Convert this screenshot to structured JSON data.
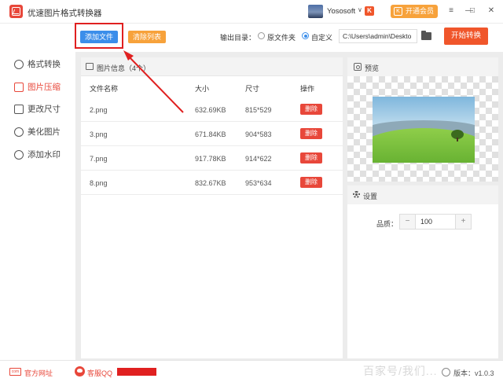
{
  "titlebar": {
    "app_title": "优速图片格式转换器",
    "user_name": "Yososoft",
    "user_caret": "∨",
    "user_badge": "K",
    "vip_label": "开通会员",
    "vip_icon": "K",
    "menu_icon": "≡",
    "minimize_icon": "—",
    "maximize_icon": "□",
    "close_icon": "✕"
  },
  "toolbar": {
    "add_file_label": "添加文件",
    "clear_list_label": "清除列表",
    "output_dir_label": "输出目录：",
    "option_source_folder": "原文件夹",
    "option_custom": "自定义",
    "output_path": "C:\\Users\\admin\\Deskto",
    "start_label": "开始转换",
    "selected_option": "自定义"
  },
  "sidebar": {
    "items": [
      {
        "label": "格式转换",
        "active": false
      },
      {
        "label": "图片压缩",
        "active": true
      },
      {
        "label": "更改尺寸",
        "active": false
      },
      {
        "label": "美化图片",
        "active": false
      },
      {
        "label": "添加水印",
        "active": false
      }
    ]
  },
  "file_panel": {
    "title": "图片信息（4个）",
    "columns": {
      "name": "文件名称",
      "size": "大小",
      "dimensions": "尺寸",
      "action": "操作"
    },
    "rows": [
      {
        "name": "2.png",
        "size": "632.69KB",
        "dimensions": "815*529",
        "action": "删除"
      },
      {
        "name": "3.png",
        "size": "671.84KB",
        "dimensions": "904*583",
        "action": "删除"
      },
      {
        "name": "7.png",
        "size": "917.78KB",
        "dimensions": "914*622",
        "action": "删除"
      },
      {
        "name": "8.png",
        "size": "832.67KB",
        "dimensions": "953*634",
        "action": "删除"
      }
    ]
  },
  "preview": {
    "title": "预览"
  },
  "settings": {
    "title": "设置",
    "quality_label": "品质：",
    "quality_value": "100",
    "minus": "−",
    "plus": "+"
  },
  "footer": {
    "site_icon_text": "com",
    "site_label": "官方网址",
    "qq_label": "客服QQ",
    "watermark": "百家号/我们...",
    "version_label": "版本：v1.0.3"
  },
  "colors": {
    "accent_red": "#e8473a",
    "accent_blue": "#3b8eea",
    "accent_orange": "#f7a23b",
    "start_button": "#f0562b",
    "annotation_red": "#e02020"
  }
}
